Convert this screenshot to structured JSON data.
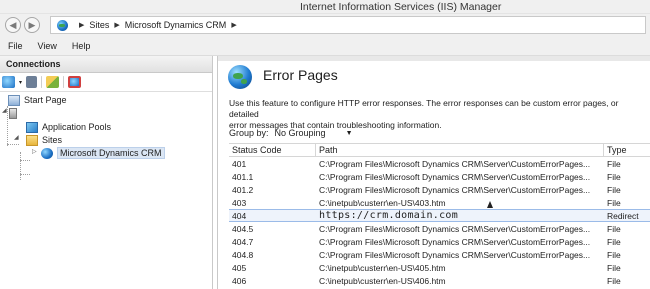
{
  "window": {
    "title": "Internet Information Services (IIS) Manager"
  },
  "address": {
    "crumbs": [
      "Sites",
      "Microsoft Dynamics CRM"
    ]
  },
  "menu": [
    "File",
    "View",
    "Help"
  ],
  "connections": {
    "header": "Connections",
    "tree": {
      "start_page": "Start Page",
      "app_pools": "Application Pools",
      "sites": "Sites",
      "site": "Microsoft Dynamics CRM"
    }
  },
  "feature": {
    "title": "Error Pages",
    "description_line1": "Use this feature to configure HTTP error responses. The error responses can be custom error pages, or detailed",
    "description_line2": "error messages that contain troubleshooting information.",
    "group_by_label": "Group by:",
    "group_by_value": "No Grouping"
  },
  "table": {
    "headers": [
      "Status Code",
      "Path",
      "Type"
    ],
    "rows": [
      {
        "code": "401",
        "path": "C:\\Program Files\\Microsoft Dynamics CRM\\Server\\CustomErrorPages...",
        "type": "File"
      },
      {
        "code": "401.1",
        "path": "C:\\Program Files\\Microsoft Dynamics CRM\\Server\\CustomErrorPages...",
        "type": "File"
      },
      {
        "code": "401.2",
        "path": "C:\\Program Files\\Microsoft Dynamics CRM\\Server\\CustomErrorPages...",
        "type": "File"
      },
      {
        "code": "403",
        "path": "C:\\inetpub\\custerr\\en-US\\403.htm",
        "type": "File"
      },
      {
        "code": "404",
        "path": "https://crm.domain.com",
        "type": "Redirect"
      },
      {
        "code": "404.5",
        "path": "C:\\Program Files\\Microsoft Dynamics CRM\\Server\\CustomErrorPages...",
        "type": "File"
      },
      {
        "code": "404.7",
        "path": "C:\\Program Files\\Microsoft Dynamics CRM\\Server\\CustomErrorPages...",
        "type": "File"
      },
      {
        "code": "404.8",
        "path": "C:\\Program Files\\Microsoft Dynamics CRM\\Server\\CustomErrorPages...",
        "type": "File"
      },
      {
        "code": "405",
        "path": "C:\\inetpub\\custerr\\en-US\\405.htm",
        "type": "File"
      },
      {
        "code": "406",
        "path": "C:\\inetpub\\custerr\\en-US\\406.htm",
        "type": "File"
      }
    ]
  }
}
